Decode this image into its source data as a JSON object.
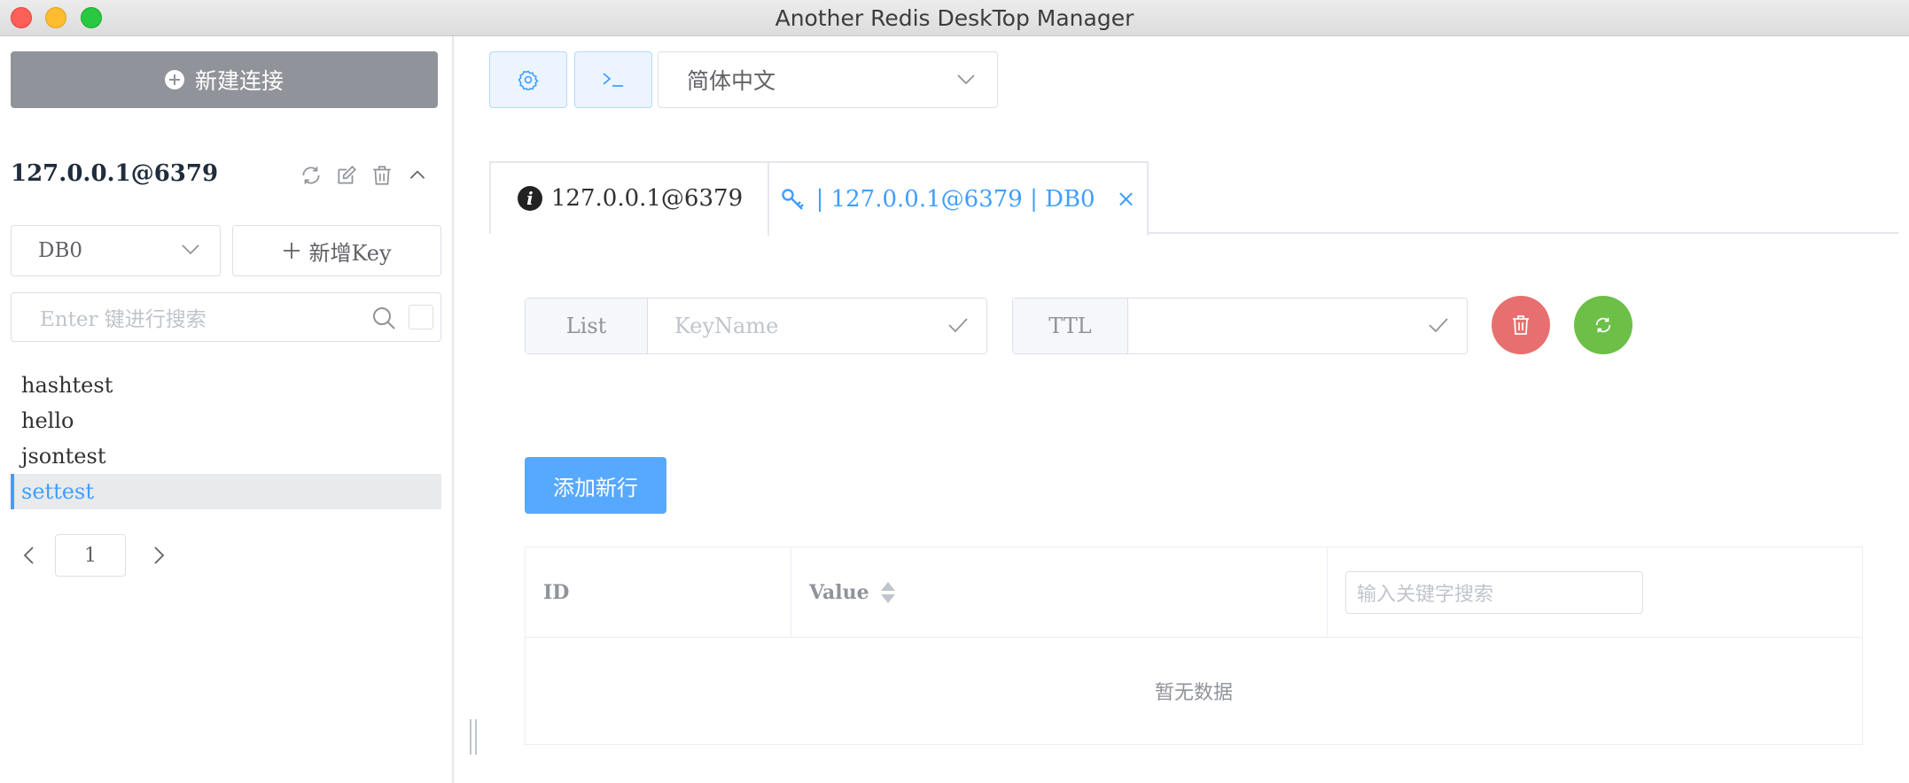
{
  "window": {
    "title": "Another Redis DeskTop Manager"
  },
  "sidebar": {
    "new_connection_label": "新建连接",
    "connection_name": "127.0.0.1@6379",
    "db_selected": "DB0",
    "add_key_label": "新增Key",
    "search_placeholder": "Enter 键进行搜索",
    "keys": [
      {
        "label": "hashtest",
        "active": false
      },
      {
        "label": "hello",
        "active": false
      },
      {
        "label": "jsontest",
        "active": false
      },
      {
        "label": "settest",
        "active": true
      }
    ],
    "page": "1"
  },
  "toolbar": {
    "language_selected": "简体中文"
  },
  "tabs": [
    {
      "label": "127.0.0.1@6379"
    },
    {
      "label": "| 127.0.0.1@6379 | DB0",
      "close": "×"
    }
  ],
  "key_editor": {
    "type_label": "List",
    "key_name_placeholder": "KeyName",
    "ttl_label": "TTL",
    "ttl_value": "",
    "add_row_label": "添加新行"
  },
  "table": {
    "columns": [
      "ID",
      "Value"
    ],
    "search_placeholder": "输入关键字搜索",
    "empty_text": "暂无数据"
  },
  "colors": {
    "primary": "#409eff",
    "danger": "#e86f6f",
    "success": "#6cbf47",
    "sidebar_button": "#909399"
  }
}
